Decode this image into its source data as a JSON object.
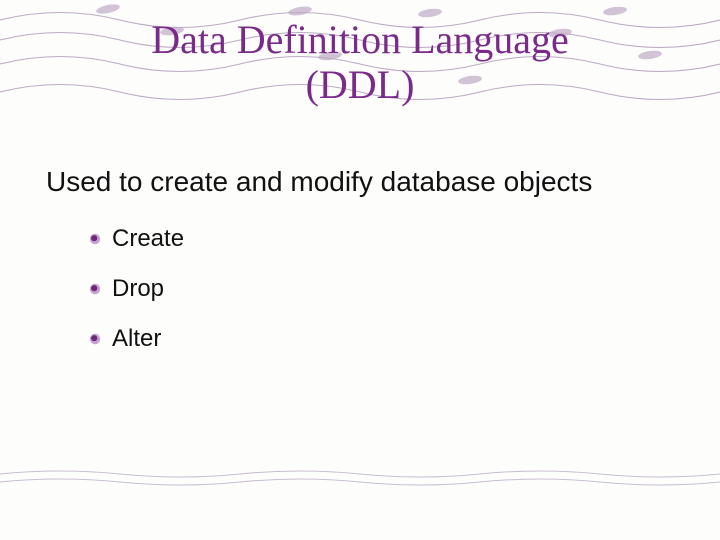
{
  "title_line1": "Data Definition Language",
  "title_line2": "(DDL)",
  "subtitle": "Used to create and modify database objects",
  "bullets": {
    "b0": "Create",
    "b1": "Drop",
    "b2": "Alter"
  },
  "colors": {
    "title": "#7a2a88",
    "bullet_dark": "#6a2a78",
    "bullet_light": "#c9a0d4"
  }
}
